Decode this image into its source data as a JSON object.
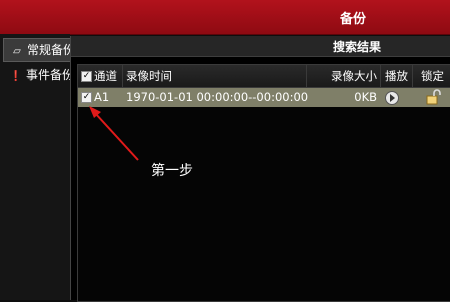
{
  "window": {
    "title": "备份"
  },
  "sidebar": {
    "items": [
      {
        "label": "常规备份",
        "icon": "folder-icon"
      },
      {
        "label": "事件备份",
        "icon": "exclamation-icon"
      }
    ]
  },
  "dialog": {
    "title": "搜索结果",
    "columns": [
      "通道号",
      "录像时间",
      "录像大小",
      "播放",
      "锁定"
    ],
    "rows": [
      {
        "checked": true,
        "channel": "A1",
        "time": "1970-01-01 00:00:00--00:00:00",
        "size": "0KB",
        "play_icon": "play-icon",
        "lock_icon": "unlock-icon"
      }
    ],
    "header_checkbox_checked": true
  },
  "annotation": {
    "text": "第一步"
  },
  "colors": {
    "title_bar": "#a0101a",
    "row_highlight": "#7f7f68",
    "arrow": "#e11a1a"
  }
}
